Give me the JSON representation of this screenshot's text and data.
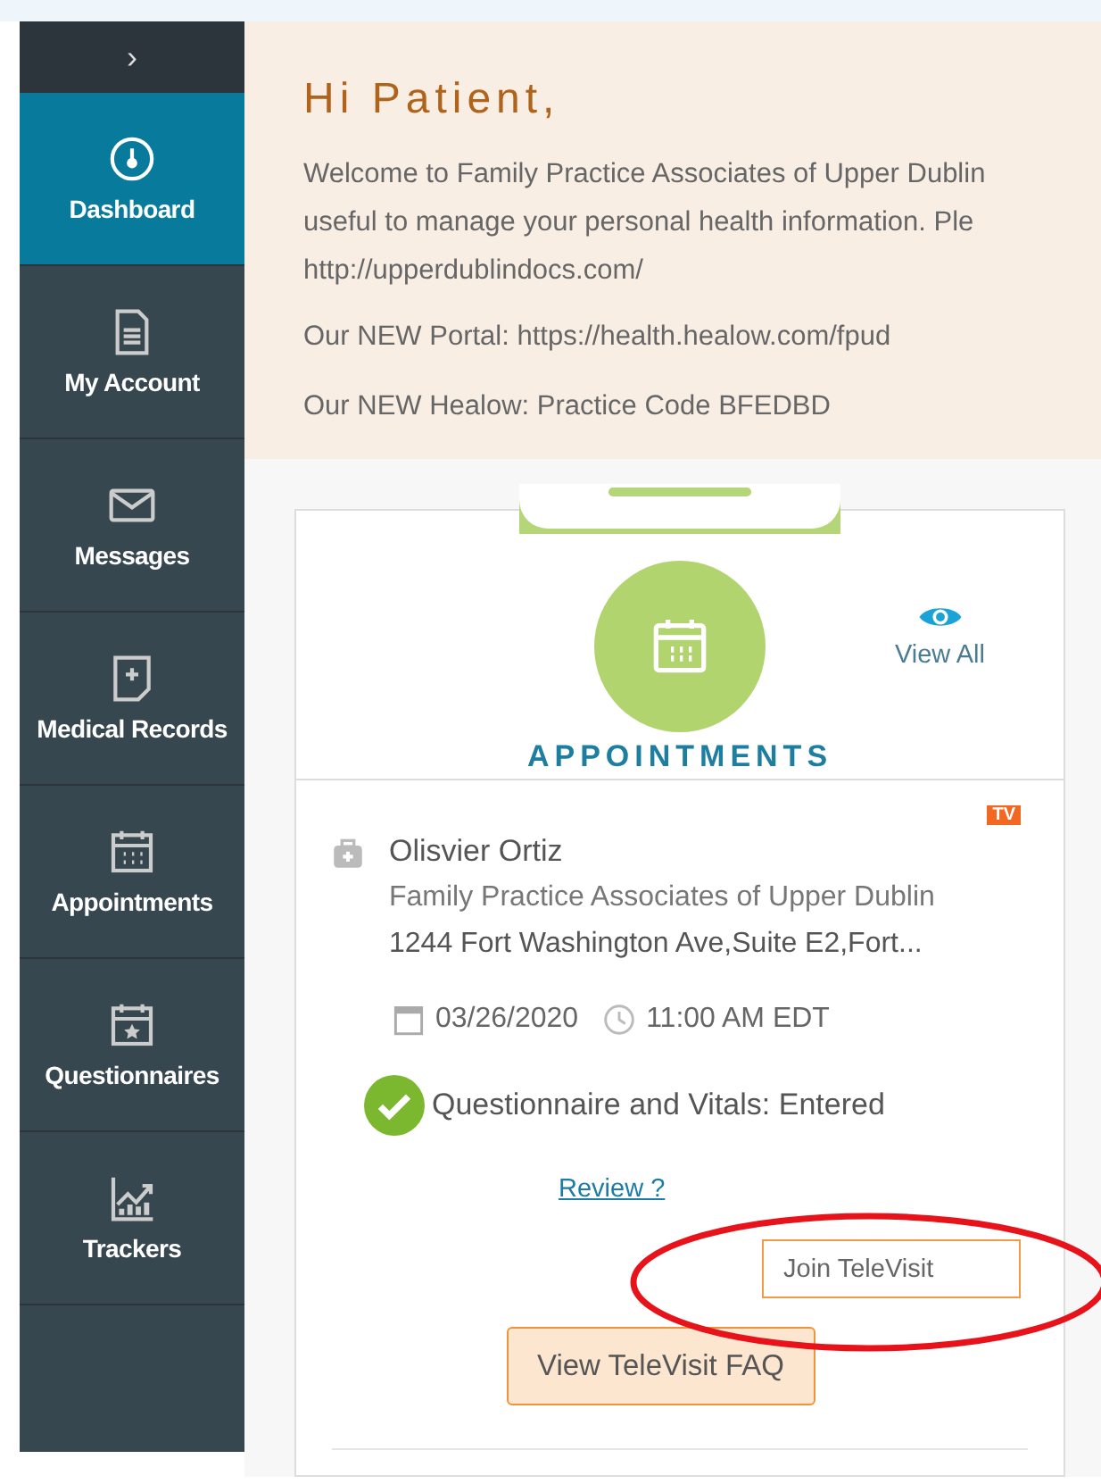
{
  "sidebar": {
    "toggle": "›",
    "items": [
      {
        "label": "Dashboard",
        "selected": true
      },
      {
        "label": "My Account",
        "selected": false
      },
      {
        "label": "Messages",
        "selected": false
      },
      {
        "label": "Medical Records",
        "selected": false
      },
      {
        "label": "Appointments",
        "selected": false
      },
      {
        "label": "Questionnaires",
        "selected": false
      },
      {
        "label": "Trackers",
        "selected": false
      }
    ]
  },
  "banner": {
    "greeting": "Hi Patient,",
    "lines": [
      "Welcome to Family Practice Associates of Upper Dublin",
      "useful to manage your personal health information. Ple",
      "http://upperdublindocs.com/"
    ],
    "notes": [
      "Our NEW Portal: https://health.healow.com/fpud",
      "Our NEW Healow: Practice Code BFEDBD"
    ]
  },
  "appointments": {
    "title": "APPOINTMENTS",
    "view_all": "View All",
    "item": {
      "badge": "TV",
      "provider": "Olisvier Ortiz",
      "practice": "Family Practice Associates of Upper Dublin",
      "address": "1244 Fort Washington Ave,Suite E2,Fort...",
      "date": "03/26/2020",
      "time": "11:00 AM EDT",
      "status": "Questionnaire and Vitals: Entered",
      "review": "Review ?",
      "join": "Join TeleVisit",
      "faq": "View TeleVisit FAQ"
    }
  }
}
